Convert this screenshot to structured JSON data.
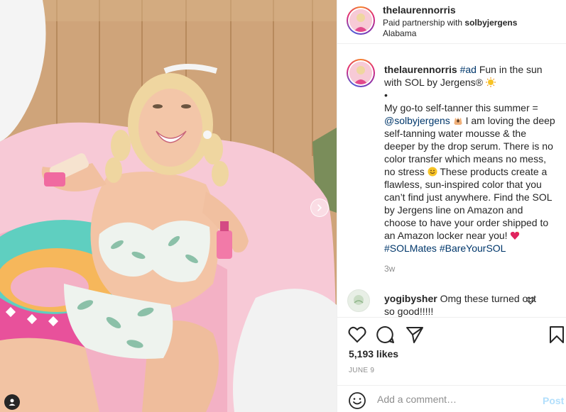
{
  "post": {
    "username": "thelaurennorris",
    "paid_prefix": "Paid partnership with ",
    "partner": "solbyjergens",
    "location": "Alabama"
  },
  "caption": {
    "username": "thelaurennorris",
    "hashtag_ad": "#ad",
    "line1_rest": " Fun in the sun with SOL by Jergens®",
    "bullet": "•",
    "text_a": "My go-to self-tanner this summer = ",
    "mention": "@solbyjergens",
    "text_b": " I am loving the deep self-tanning water mousse & the deeper by the drop serum. There is no color transfer which means no mess, no stress",
    "text_c": " These products create a flawless, sun-inspired color that you can’t find just anywhere. Find the SOL by Jergens line on Amazon and choose to have your order shipped to an Amazon locker near you!",
    "hashtags": "#SOLMates #BareYourSOL",
    "time_ago": "3w"
  },
  "comment": {
    "username": "yogibysher",
    "text": " Omg these turned out so good!!!!!"
  },
  "actions": {
    "likes": "5,193 likes",
    "date": "JUNE 9"
  },
  "add_comment": {
    "placeholder": "Add a comment…",
    "post_label": "Post"
  },
  "colors": {
    "link": "#00376b",
    "muted": "#8e8e8e",
    "post_button": "#b2dffc",
    "text": "#262626"
  },
  "icons": [
    "heart-icon",
    "comment-icon",
    "share-icon",
    "bookmark-icon",
    "smile-icon",
    "chevron-right-icon",
    "user-tag-icon"
  ]
}
